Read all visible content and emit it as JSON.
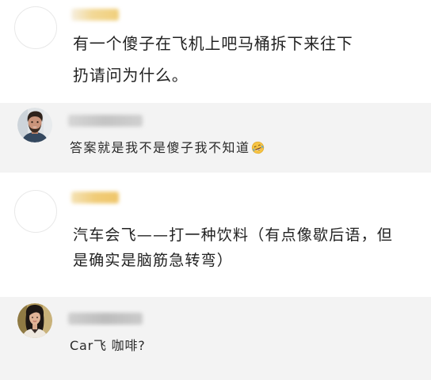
{
  "thread": {
    "comments": [
      {
        "avatar_icon": "blank-avatar-icon",
        "username_blur_color": "linear-gradient(90deg, #f6efe0 0%, #f2d896 45%, #f0cf7c 100%)",
        "lines": [
          "有一个傻子在飞机上吧马桶拆下来往下",
          "扔请问为什么。"
        ],
        "reply": {
          "avatar_icon": "man-photo-avatar-icon",
          "username_blur_color": "linear-gradient(90deg, #d6d6d6 0%, #c4c4c4 50%, #d0d0d0 100%)",
          "text": "答案就是我不是傻子我不知道",
          "emoji_icon": "laughing-crying-icon"
        }
      },
      {
        "avatar_icon": "blank-avatar-icon",
        "username_blur_color": "linear-gradient(90deg, #f4e2b4 0%, #f0cc78 50%, #efc66a 100%)",
        "lines": [
          "汽车会飞——打一种饮料（有点像歇后语，但",
          "是确实是脑筋急转弯）"
        ],
        "reply": {
          "avatar_icon": "woman-photo-avatar-icon",
          "username_blur_color": "linear-gradient(90deg, #cfcfcf 0%, #bdbdbd 50%, #cbcbcb 100%)",
          "text": "Car飞 咖啡?"
        }
      }
    ]
  },
  "colors": {
    "page_background": "#ffffff",
    "reply_background": "#f3f3f3",
    "text": "#222222",
    "avatar_border": "#e8e8e8"
  }
}
